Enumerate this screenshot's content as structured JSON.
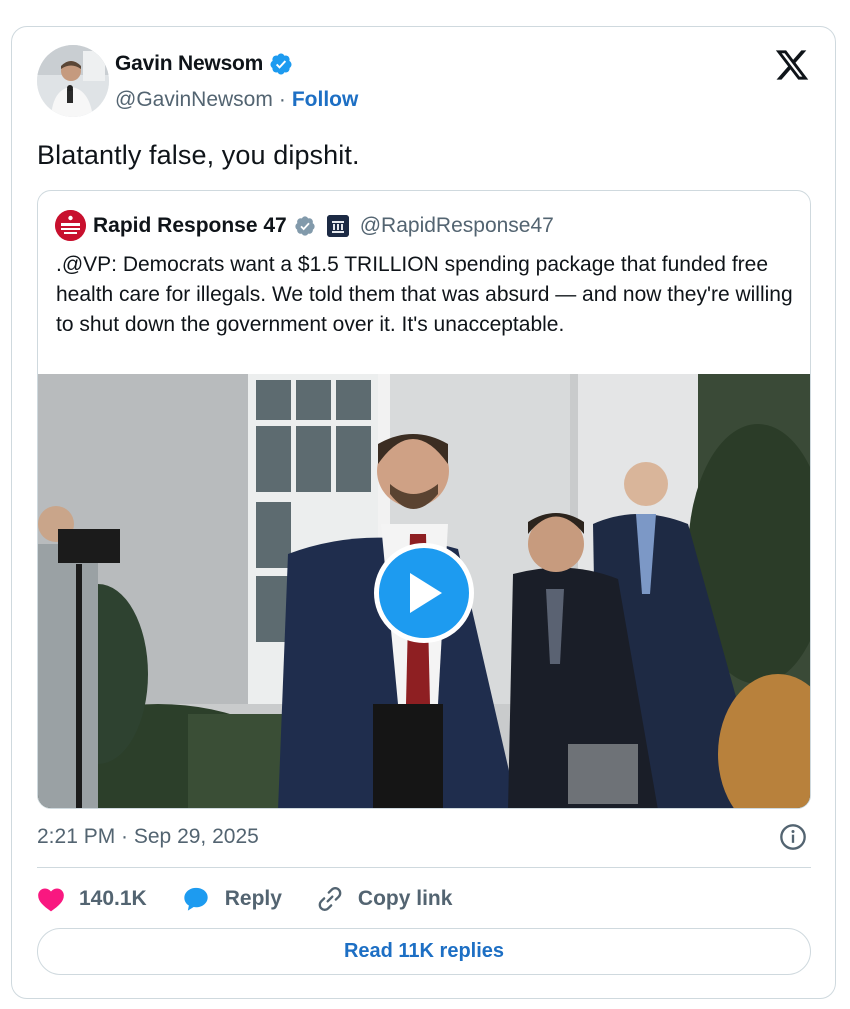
{
  "tweet": {
    "author_name": "Gavin Newsom",
    "author_handle": "@GavinNewsom",
    "separator": "·",
    "follow_label": "Follow",
    "text": "Blatantly false, you dipshit.",
    "timestamp": "2:21 PM · Sep 29, 2025"
  },
  "quote": {
    "author_name": "Rapid Response 47",
    "author_handle": "@RapidResponse47",
    "text": ".@VP: Democrats want a $1.5 TRILLION spending package that funded free health care for illegals. We told them that was absurd — and now they're willing to shut down the government over it. It's unacceptable.",
    "media_type": "video"
  },
  "actions": {
    "like_count": "140.1K",
    "reply_label": "Reply",
    "copy_link_label": "Copy link",
    "read_replies_label": "Read 11K replies"
  },
  "colors": {
    "accent_blue": "#1d9bf0",
    "link_blue": "#1d6fc4",
    "like_pink": "#f91880",
    "verified_blue": "#1d9bf0",
    "border": "#cfd9de",
    "muted_text": "#536471"
  },
  "icons": {
    "verified": "verified-badge-icon",
    "x_logo": "x-logo-icon",
    "play": "play-icon",
    "info": "info-icon",
    "like": "heart-icon",
    "reply": "reply-bubble-icon",
    "copy_link": "link-icon"
  }
}
